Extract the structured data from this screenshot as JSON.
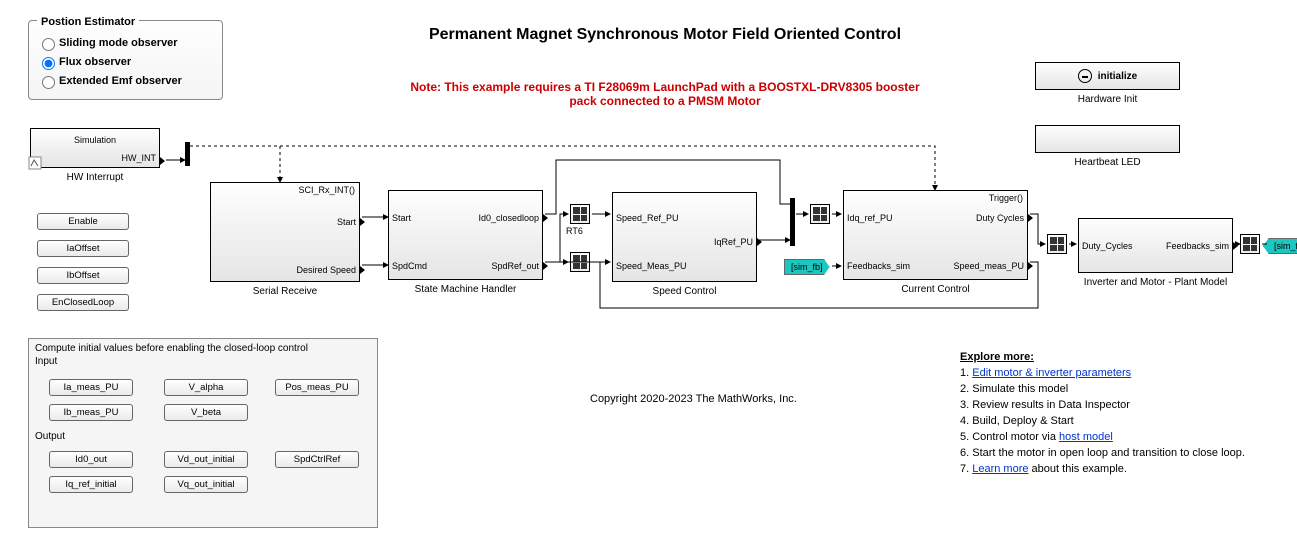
{
  "title": "Permanent Magnet Synchronous Motor Field Oriented Control",
  "note": "Note: This example requires a TI F28069m LaunchPad with a BOOSTXL-DRV8305 booster pack connected to a PMSM Motor",
  "copyright": "Copyright 2020-2023 The MathWorks, Inc.",
  "estimator": {
    "title": "Postion Estimator",
    "opt1": "Sliding mode observer",
    "opt2": "Flux observer",
    "opt3": "Extended Emf observer"
  },
  "hw_interrupt": {
    "sim": "Simulation",
    "out": "HW_INT",
    "label": "HW Interrupt"
  },
  "btns": {
    "enable": "Enable",
    "iaoff": "IaOffset",
    "iboff": "IbOffset",
    "enclosed": "EnClosedLoop"
  },
  "serial": {
    "trig": "SCI_Rx_INT()",
    "p1": "Start",
    "p2": "Desired Speed",
    "label": "Serial Receive"
  },
  "smh": {
    "in1": "Start",
    "in2": "SpdCmd",
    "out1": "Id0_closedloop",
    "out2": "SpdRef_out",
    "label": "State Machine Handler"
  },
  "rt6": "RT6",
  "speed": {
    "in1": "Speed_Ref_PU",
    "in2": "Speed_Meas_PU",
    "out1": "IqRef_PU",
    "label": "Speed Control"
  },
  "current": {
    "trig": "Trigger()",
    "in1": "Idq_ref_PU",
    "in2": "Feedbacks_sim",
    "out1": "Duty Cycles",
    "out2": "Speed_meas_PU",
    "label": "Current Control"
  },
  "inverter": {
    "in1": "Duty_Cycles",
    "out1": "Feedbacks_sim",
    "label": "Inverter and Motor - Plant Model"
  },
  "hwinit": {
    "text": "initialize",
    "label": "Hardware Init"
  },
  "heartbeat": {
    "label": "Heartbeat LED"
  },
  "tags": {
    "simfb": "[sim_fb]"
  },
  "compute": {
    "header": "Compute initial values before enabling the closed-loop control",
    "input": "Input",
    "output": "Output",
    "ia": "Ia_meas_PU",
    "ib": "Ib_meas_PU",
    "va": "V_alpha",
    "vb": "V_beta",
    "pos": "Pos_meas_PU",
    "id0": "Id0_out",
    "iqr": "Iq_ref_initial",
    "vd": "Vd_out_initial",
    "vq": "Vq_out_initial",
    "spd": "SpdCtrlRef"
  },
  "explore": {
    "header": "Explore more:",
    "s1a": "1. ",
    "s1b": "Edit motor & inverter parameters",
    "s2": "2. Simulate this model",
    "s3": "3. Review results in Data Inspector",
    "s4": "4. Build, Deploy & Start",
    "s5a": "5. Control motor via ",
    "s5b": "host model",
    "s6": "6. Start the motor in open loop and transition to close loop.",
    "s7a": "7. ",
    "s7b": "Learn more",
    "s7c": " about this example."
  }
}
